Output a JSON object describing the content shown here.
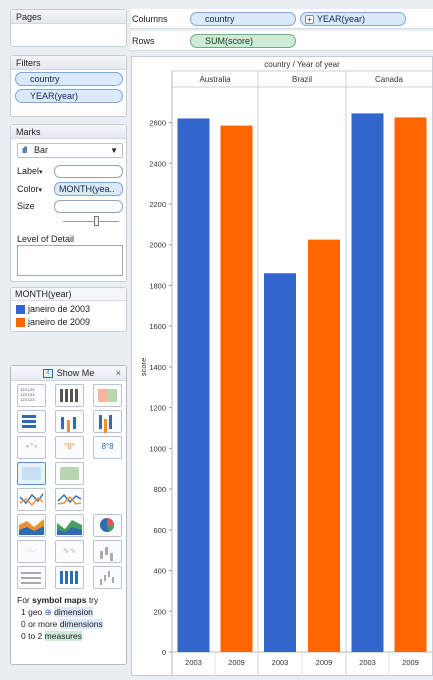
{
  "panels": {
    "pages": "Pages",
    "filters": "Filters",
    "marks": "Marks",
    "legend_title": "MONTH(year)",
    "show_me": "Show Me"
  },
  "shelves": {
    "columns_label": "Columns",
    "rows_label": "Rows",
    "columns_pills": [
      "country",
      "YEAR(year)"
    ],
    "rows_pill": "SUM(score)"
  },
  "filters": [
    "country",
    "YEAR(year)"
  ],
  "marks": {
    "type": "Bar",
    "label": "Label",
    "color": "Color",
    "color_field": "MONTH(yea..",
    "size": "Size",
    "level_of_detail": "Level of Detail"
  },
  "legend": [
    {
      "label": "janeiro de 2003",
      "color": "#3366cc"
    },
    {
      "label": "janeiro de 2009",
      "color": "#ff6600"
    }
  ],
  "show_me_hint": {
    "prefix": "For ",
    "bold": "symbol maps",
    "suffix": " try",
    "line1_num": "1 geo",
    "line1_key": "dimension",
    "line2_num": "0 or more",
    "line2_key": "dimensions",
    "line3_num": "0 to 2",
    "line3_key": "measures"
  },
  "chart_data": {
    "type": "bar",
    "header": "country  /  Year of year",
    "ylabel": "score",
    "ylim": [
      0,
      2750
    ],
    "yticks": [
      0,
      200,
      400,
      600,
      800,
      1000,
      1200,
      1400,
      1600,
      1800,
      2000,
      2200,
      2400,
      2600
    ],
    "panes": [
      {
        "country": "Australia",
        "categories": [
          "2003",
          "2009"
        ],
        "values": [
          2620,
          2585
        ]
      },
      {
        "country": "Brazil",
        "categories": [
          "2003",
          "2009"
        ],
        "values": [
          1860,
          2025
        ]
      },
      {
        "country": "Canada",
        "categories": [
          "2003",
          "2009"
        ],
        "values": [
          2645,
          2625
        ]
      }
    ],
    "colors": [
      "#3366cc",
      "#ff6600"
    ]
  }
}
